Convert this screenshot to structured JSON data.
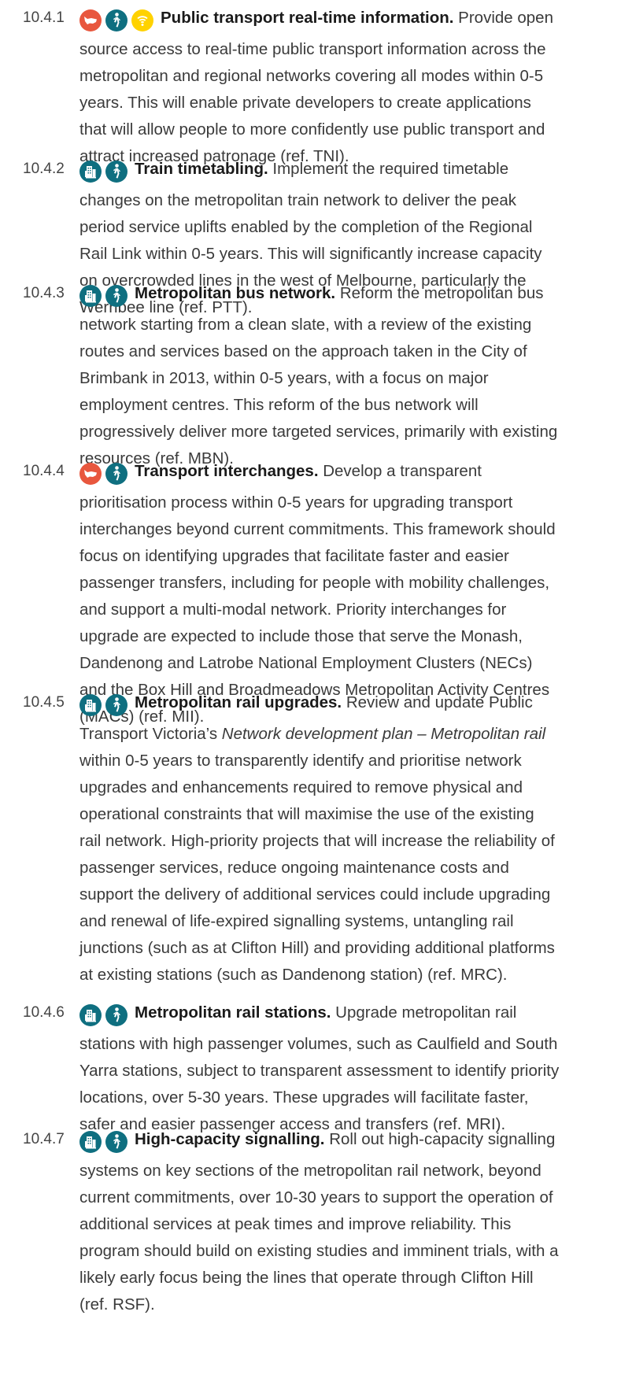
{
  "items": [
    {
      "number": "10.4.1",
      "icons": [
        "victoria-map-icon",
        "pedestrian-icon",
        "wifi-icon"
      ],
      "title": "Public transport real-time information.",
      "text": " Provide open source access to real-time public transport information across the metropolitan and regional networks covering all modes within 0-5 years. This will enable private developers to create applications that will allow people to more confidently use public transport and attract increased patronage (ref. TNI)."
    },
    {
      "number": "10.4.2",
      "icons": [
        "city-buildings-icon",
        "pedestrian-icon"
      ],
      "title": "Train timetabling.",
      "text": " Implement the required timetable changes on the metropolitan train network to deliver the peak period service uplifts enabled by the completion of the Regional Rail Link within 0-5 years. This will significantly increase capacity on overcrowded lines in the west of Melbourne, particularly the Werribee line (ref. PTT)."
    },
    {
      "number": "10.4.3",
      "icons": [
        "city-buildings-icon",
        "pedestrian-icon"
      ],
      "title": "Metropolitan bus network.",
      "text": " Reform the metropolitan bus network starting from a clean slate, with a review of the existing routes and services based on the approach taken in the City of Brimbank in 2013, within 0-5 years, with a focus on major employment centres. This reform of the bus network will progressively deliver more targeted services, primarily with existing resources (ref. MBN)."
    },
    {
      "number": "10.4.4",
      "icons": [
        "victoria-map-icon",
        "pedestrian-icon"
      ],
      "title": "Transport interchanges.",
      "text": " Develop a transparent prioritisation process within 0-5 years for upgrading transport interchanges beyond current commitments. This framework should focus on identifying upgrades that facilitate faster and easier passenger transfers, including for people with mobility challenges, and support a multi-modal network. Priority interchanges for upgrade are expected to include those that serve the Monash, Dandenong and Latrobe National Employment Clusters (NECs) and the Box Hill and Broadmeadows Metropolitan Activity Centres (MACs) (ref. MII)."
    },
    {
      "number": "10.4.5",
      "icons": [
        "city-buildings-icon",
        "pedestrian-icon"
      ],
      "title": "Metropolitan rail upgrades.",
      "text_before": " Review and update Public Transport Victoria’s ",
      "doc_title": "Network development plan – Metropolitan rail",
      "text": " within 0-5 years to transparently identify and prioritise network upgrades and enhancements required to remove physical and operational constraints that will maximise the use of the existing rail network. High-priority projects that will increase the reliability of passenger services, reduce ongoing maintenance costs and support the delivery of additional services could include upgrading and renewal of life-expired signalling systems, untangling rail junctions (such as at Clifton Hill) and providing additional platforms at existing stations (such as Dandenong station) (ref. MRC)."
    },
    {
      "number": "10.4.6",
      "icons": [
        "city-buildings-icon",
        "pedestrian-icon"
      ],
      "title": "Metropolitan rail stations.",
      "text": " Upgrade metropolitan rail stations with high passenger volumes, such as Caulfield and South Yarra stations, subject to transparent assessment to identify priority locations, over 5-30 years. These upgrades will facilitate faster, safer and easier passenger access and transfers (ref. MRI)."
    },
    {
      "number": "10.4.7",
      "icons": [
        "city-buildings-icon",
        "pedestrian-icon"
      ],
      "title": "High-capacity signalling.",
      "text": " Roll out high-capacity signalling systems on key sections of the metropolitan rail network, beyond current commitments, over 10-30 years to support the operation of additional services at peak times and improve reliability. This program should build on existing studies and imminent trials, with a likely early focus being the lines that operate through Clifton Hill (ref. RSF)."
    }
  ],
  "colors": {
    "teal": "#0f6f80",
    "red": "#e8573e",
    "yellow": "#ffd200",
    "text": "#3a3a3a",
    "title": "#1a1a1a"
  }
}
